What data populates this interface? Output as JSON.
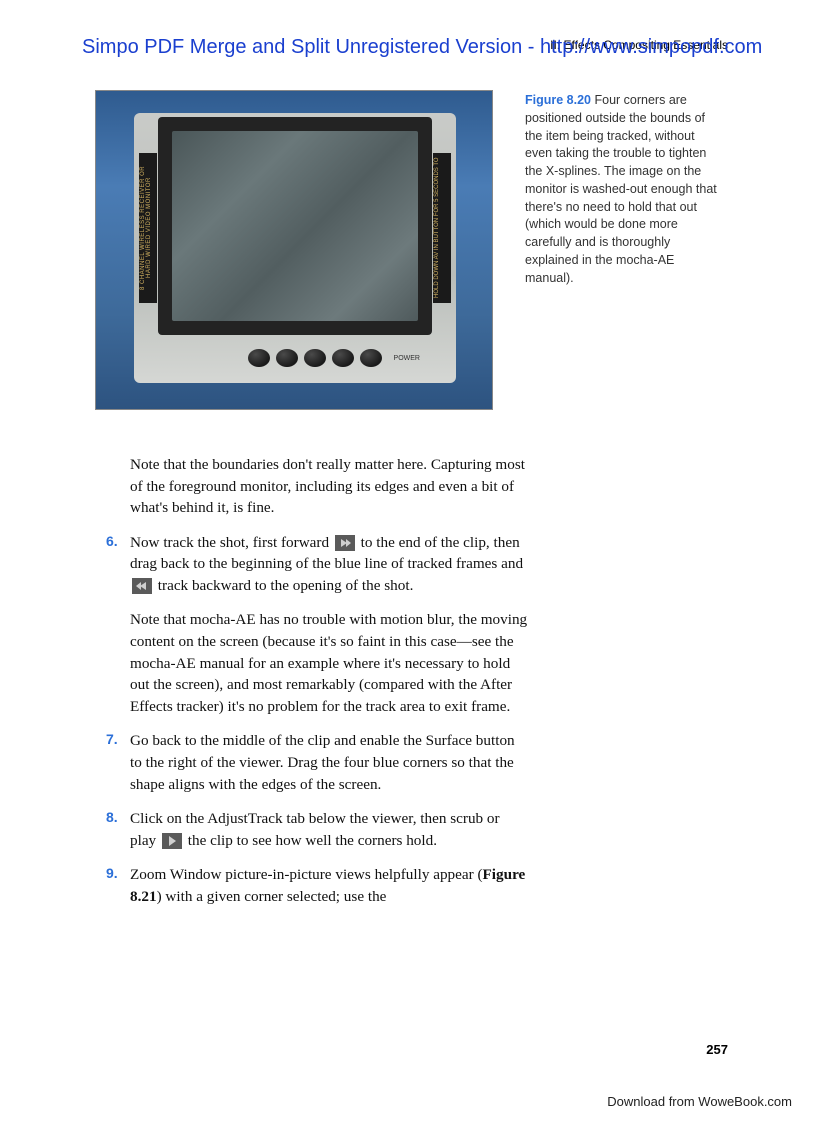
{
  "watermark": "Simpo PDF Merge and Split Unregistered Version - http://www.simpopdf.com",
  "header_right": "II: Effects Compositing Essentials",
  "caption": {
    "label": "Figure 8.20",
    "text": "Four corners are positioned outside the bounds of the item being tracked, without even taking the trouble to tighten the X-splines. The image on the monitor is washed-out enough that there's no need to hold that out (which would be done more carefully and is thoroughly explained in the mocha-AE manual)."
  },
  "monitor_labels": {
    "left": "8 CHANNEL WIRELESS RECEIVER  OR HARD WIRED VIDEO MONITOR",
    "right": "HOLD DOWN AV IN BUTTON FOR 5 SECONDS TO",
    "power": "POWER"
  },
  "body": {
    "p1": "Note that the boundaries don't really matter here. Capturing most of the foreground monitor, including its edges and even a bit of what's behind it, is fine.",
    "s6a": "Now track the shot, first forward ",
    "s6b": " to the end of the clip, then drag back to the beginning of the blue line of tracked frames and ",
    "s6c": " track backward to the opening of the shot.",
    "p2": "Note that mocha-AE has no trouble with motion blur, the moving content on the screen (because it's so faint in this case—see the mocha-AE manual for an example where it's necessary to hold out the screen), and most remarkably (compared with the After Effects tracker) it's no problem for the track area to exit frame.",
    "s7": "Go back to the middle of the clip and enable the Surface button to the right of the viewer. Drag the four blue corners so that the shape aligns with the edges of the screen.",
    "s8a": "Click on the AdjustTrack tab below the viewer, then scrub or play ",
    "s8b": " the clip to see how well the corners hold.",
    "s9a": "Zoom Window picture-in-picture views helpfully appear (",
    "s9b": "Figure 8.21",
    "s9c": ") with a given corner selected; use the"
  },
  "step_nums": {
    "six": "6.",
    "seven": "7.",
    "eight": "8.",
    "nine": "9."
  },
  "page_number": "257",
  "footer": "Download from WoweBook.com"
}
